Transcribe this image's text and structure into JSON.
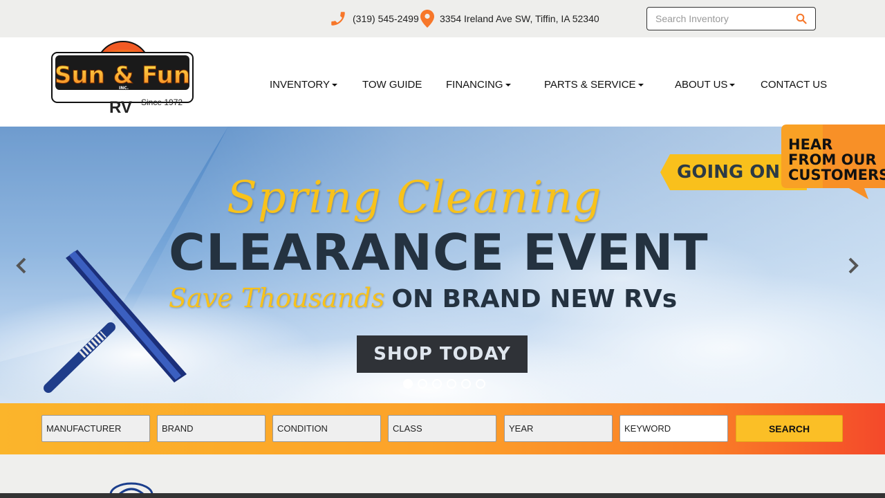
{
  "topbar": {
    "phone": "(319) 545-2499",
    "address": "3354 Ireland Ave SW, Tiffin, IA 52340",
    "search_placeholder": "Search Inventory"
  },
  "logo": {
    "brand": "Sun & Fun",
    "inc": "INC.",
    "sub": "RV",
    "since": "Since 1972"
  },
  "nav": [
    {
      "label": "INVENTORY",
      "dropdown": true
    },
    {
      "label": "TOW GUIDE",
      "dropdown": false
    },
    {
      "label": "FINANCING",
      "dropdown": true
    },
    {
      "label": "PARTS & SERVICE",
      "dropdown": true
    },
    {
      "label": "ABOUT US",
      "dropdown": true
    },
    {
      "label": "CONTACT US",
      "dropdown": false
    }
  ],
  "hero": {
    "script_title": "Spring Cleaning",
    "main_title": "CLEARANCE EVENT",
    "save_script": "Save Thousands",
    "save_bold": "ON BRAND NEW RVs",
    "cta": "SHOP TODAY",
    "going_on": "GOING ON N",
    "slide_count": 6,
    "active_slide": 1
  },
  "testimonial_tab": {
    "line1": "HEAR",
    "line2": "FROM OUR",
    "line3": "CUSTOMERS"
  },
  "search_bar": {
    "fields": [
      "MANUFACTURER",
      "BRAND",
      "CONDITION",
      "CLASS",
      "YEAR",
      "KEYWORD"
    ],
    "button": "SEARCH"
  },
  "colors": {
    "accent_orange": "#f7772a",
    "brand_yellow": "#f8c21b",
    "dark_text": "#243240"
  },
  "icons": {
    "phone": "phone-icon",
    "location": "map-pin-icon",
    "search": "search-icon",
    "prev": "chevron-left-icon",
    "next": "chevron-right-icon"
  }
}
